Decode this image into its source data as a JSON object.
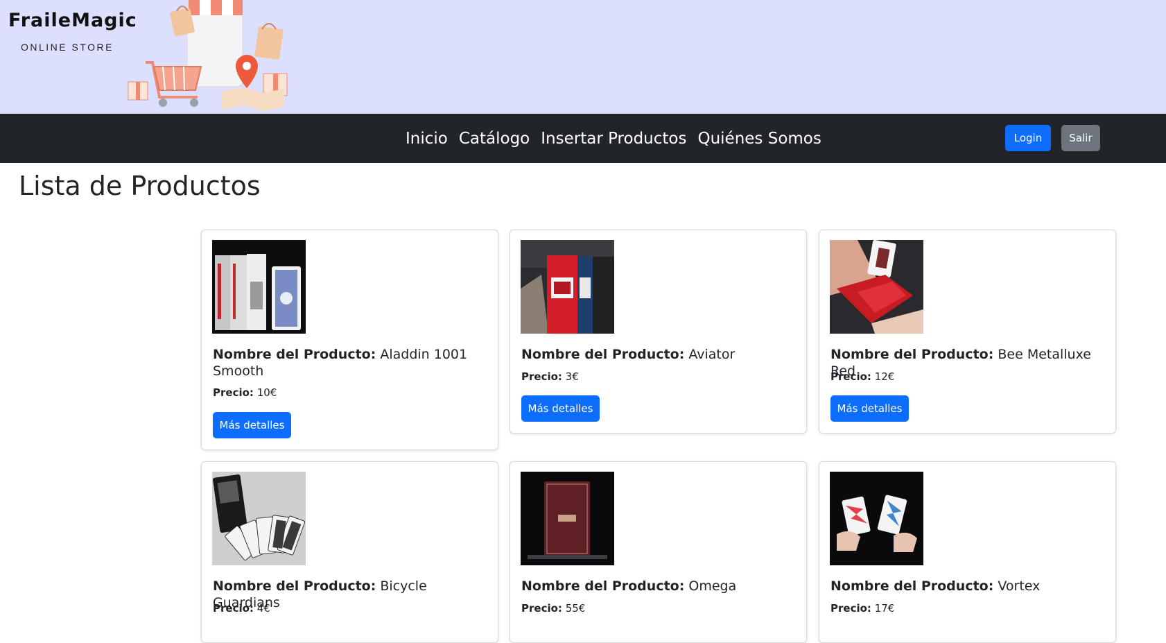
{
  "brand": {
    "name": "FraileMagic",
    "tagline": "ONLINE STORE"
  },
  "nav": {
    "links": [
      "Inicio",
      "Catálogo",
      "Insertar Productos",
      "Quiénes Somos"
    ],
    "login_label": "Login",
    "logout_label": "Salir"
  },
  "page": {
    "title": "Lista de Productos"
  },
  "labels": {
    "name_prefix": "Nombre del Producto:",
    "price_prefix": "Precio:",
    "details_button": "Más detalles"
  },
  "products": [
    {
      "name": "Aladdin 1001 Smooth",
      "price": "10€"
    },
    {
      "name": "Aviator",
      "price": "3€"
    },
    {
      "name": "Bee Metalluxe Red",
      "price": "12€"
    },
    {
      "name": "Bicycle Guardians",
      "price": "4€"
    },
    {
      "name": "Omega",
      "price": "55€"
    },
    {
      "name": "Vortex",
      "price": "17€"
    }
  ],
  "colors": {
    "banner_bg": "#dcdffe",
    "navbar_bg": "#212529",
    "primary": "#0d6efd",
    "secondary": "#6c757d"
  }
}
